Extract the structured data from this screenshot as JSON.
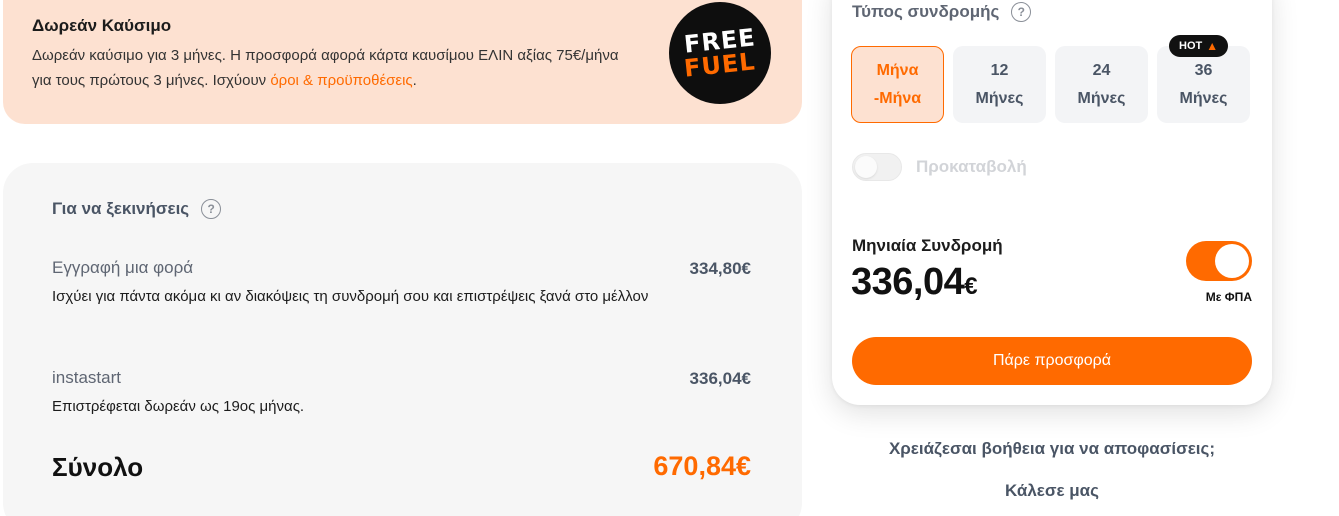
{
  "promo": {
    "title": "Δωρεάν Καύσιμο",
    "description": "Δωρεάν καύσιμο για 3 μήνες. Η προσφορά αφορά κάρτα καυσίμου ΕΛΙΝ αξίας 75€/μήνα για τους πρώτους 3 μήνες. Ισχύουν ",
    "link_text": "όροι & προϋποθέσεις",
    "description_end": ".",
    "badge_line1": "FREE",
    "badge_line2": "FUEL"
  },
  "breakdown": {
    "title": "Για να ξεκινήσεις",
    "help_icon": "?",
    "items": [
      {
        "label": "Εγγραφή μια φορά",
        "price": "334,80€",
        "note": "Ισχύει για πάντα ακόμα κι αν διακόψεις τη συνδρομή σου και επιστρέψεις ξανά στο μέλλον"
      },
      {
        "label": "instastart",
        "price": "336,04€",
        "note": "Επιστρέφεται δωρεάν ως 19ος μήνας."
      }
    ],
    "total_label": "Σύνολο",
    "total_value": "670,84€"
  },
  "subscription": {
    "title": "Τύπος συνδρομής",
    "help_icon": "?",
    "terms": [
      {
        "line1": "Μήνα",
        "line2": "-Μήνα",
        "active": true
      },
      {
        "line1": "12",
        "line2": "Μήνες",
        "active": false
      },
      {
        "line1": "24",
        "line2": "Μήνες",
        "active": false
      },
      {
        "line1": "36",
        "line2": "Μήνες",
        "active": false
      }
    ],
    "hot_badge": "HOT",
    "hot_icon": "flame-icon",
    "prepay_label": "Προκαταβολή",
    "prepay_enabled": false,
    "monthly_label": "Μηνιαία Συνδρομή",
    "monthly_amount": "336,04",
    "currency": "€",
    "vat_toggle_on": true,
    "vat_label": "Με ΦΠΑ",
    "cta_label": "Πάρε προσφορά"
  },
  "help": {
    "question": "Χρειάζεσαι βοήθεια για να αποφασίσεις;",
    "call": "Κάλεσε μας"
  },
  "colors": {
    "accent": "#ff6a00",
    "promo_bg": "#fde1d1",
    "card_bg": "#f6f6f6"
  }
}
